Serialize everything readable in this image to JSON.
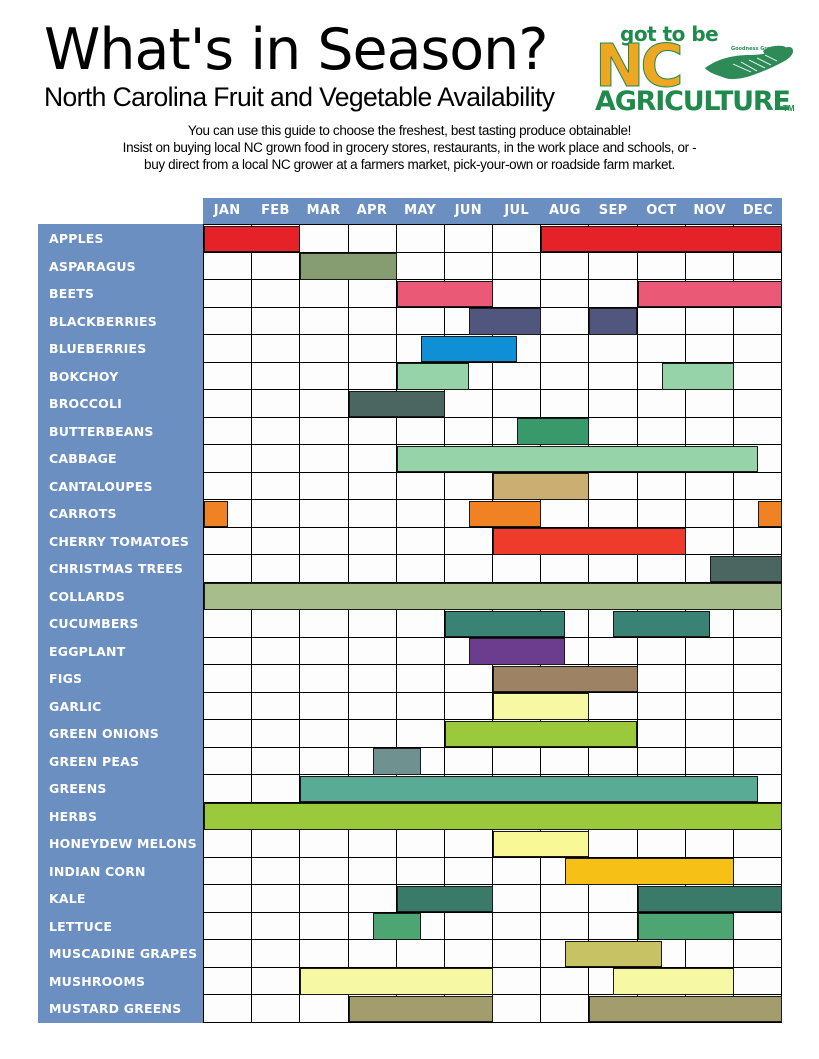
{
  "header": {
    "title": "What's in Season?",
    "subtitle": "North Carolina Fruit and Vegetable Availability",
    "tagline": [
      "You can use this guide to choose the freshest, best tasting produce obtainable!",
      "Insist on buying local NC grown food in grocery stores, restaurants, in the work place and schools, or -",
      "buy direct from a local NC grower at a farmers market, pick-your-own or roadside farm market."
    ],
    "logo": {
      "line1": "got to be",
      "line2": "NC",
      "line3": "AGRICULTURE",
      "trademark": "TM",
      "color_orange": "#eda722",
      "color_green": "#1f8a4c"
    }
  },
  "colors": {
    "sidebar_blue": "#6b8fc0",
    "grid_line": "#000000",
    "cell_background": "#fdfdfd"
  },
  "chart_data": {
    "type": "heatmap",
    "title": "What's in Season? North Carolina Fruit and Vegetable Availability",
    "xlabel": "",
    "ylabel": "",
    "grid": true,
    "legend": "none",
    "categories": [
      "JAN",
      "FEB",
      "MAR",
      "APR",
      "MAY",
      "JUN",
      "JUL",
      "AUG",
      "SEP",
      "OCT",
      "NOV",
      "DEC"
    ],
    "note": "Each row's 'bars' give availability spans as fractional month indices (0 = start of JAN, 12 = end of DEC).",
    "rows": [
      {
        "name": "APPLES",
        "color": "#e62229",
        "bars": [
          [
            0,
            2
          ],
          [
            7,
            12
          ]
        ]
      },
      {
        "name": "ASPARAGUS",
        "color": "#869c71",
        "bars": [
          [
            2,
            4
          ]
        ]
      },
      {
        "name": "BEETS",
        "color": "#ea5a77",
        "bars": [
          [
            4,
            6
          ],
          [
            9,
            12
          ]
        ]
      },
      {
        "name": "BLACKBERRIES",
        "color": "#51567f",
        "bars": [
          [
            5.5,
            7
          ],
          [
            8,
            9
          ]
        ]
      },
      {
        "name": "BLUEBERRIES",
        "color": "#0e8fd6",
        "bars": [
          [
            4.5,
            6.5
          ]
        ]
      },
      {
        "name": "BOKCHOY",
        "color": "#96d3a8",
        "bars": [
          [
            4,
            5.5
          ],
          [
            9.5,
            11
          ]
        ]
      },
      {
        "name": "BROCCOLI",
        "color": "#4b6660",
        "bars": [
          [
            3,
            5
          ]
        ]
      },
      {
        "name": "BUTTERBEANS",
        "color": "#389a6a",
        "bars": [
          [
            6.5,
            8
          ]
        ]
      },
      {
        "name": "CABBAGE",
        "color": "#96d3a8",
        "bars": [
          [
            4,
            11.5
          ]
        ]
      },
      {
        "name": "CANTALOUPES",
        "color": "#cbae72",
        "bars": [
          [
            6,
            8
          ]
        ]
      },
      {
        "name": "CARROTS",
        "color": "#f18224",
        "bars": [
          [
            0,
            0.5
          ],
          [
            5.5,
            7
          ],
          [
            11.5,
            12
          ]
        ]
      },
      {
        "name": "CHERRY   TOMATOES",
        "color": "#ee3b2b",
        "bars": [
          [
            6,
            10
          ]
        ]
      },
      {
        "name": "CHRISTMAS TREES",
        "color": "#4b6660",
        "bars": [
          [
            10.5,
            12
          ]
        ]
      },
      {
        "name": "COLLARDS",
        "color": "#a7bd8c",
        "bars": [
          [
            0,
            12
          ]
        ]
      },
      {
        "name": "CUCUMBERS",
        "color": "#3a8273",
        "bars": [
          [
            5,
            7.5
          ],
          [
            8.5,
            10.5
          ]
        ]
      },
      {
        "name": "EGGPLANT",
        "color": "#6c3d8e",
        "bars": [
          [
            5.5,
            7.5
          ]
        ]
      },
      {
        "name": "FIGS",
        "color": "#9e8264",
        "bars": [
          [
            6,
            9
          ]
        ]
      },
      {
        "name": "GARLIC",
        "color": "#f7f8a4",
        "bars": [
          [
            6,
            8
          ]
        ]
      },
      {
        "name": "GREEN ONIONS",
        "color": "#9ac93c",
        "bars": [
          [
            5,
            9
          ]
        ]
      },
      {
        "name": "GREEN PEAS",
        "color": "#6f9291",
        "bars": [
          [
            3.5,
            4.5
          ]
        ]
      },
      {
        "name": "GREENS",
        "color": "#59ab96",
        "bars": [
          [
            2,
            11.5
          ]
        ]
      },
      {
        "name": "HERBS",
        "color": "#9ac93c",
        "bars": [
          [
            0,
            12
          ]
        ]
      },
      {
        "name": "HONEYDEW MELONS",
        "color": "#f8f996",
        "bars": [
          [
            6,
            8
          ]
        ]
      },
      {
        "name": "INDIAN CORN",
        "color": "#f6c016",
        "bars": [
          [
            7.5,
            11
          ]
        ]
      },
      {
        "name": "KALE",
        "color": "#3a7a68",
        "bars": [
          [
            4,
            6
          ],
          [
            9,
            12
          ]
        ]
      },
      {
        "name": "LETTUCE",
        "color": "#4da571",
        "bars": [
          [
            3.5,
            4.5
          ],
          [
            9,
            11
          ]
        ]
      },
      {
        "name": "MUSCADINE GRAPES",
        "color": "#c7c263",
        "bars": [
          [
            7.5,
            9.5
          ]
        ]
      },
      {
        "name": "MUSHROOMS",
        "color": "#f7f8a4",
        "bars": [
          [
            2,
            6
          ],
          [
            8.5,
            11
          ]
        ]
      },
      {
        "name": "MUSTARD GREENS",
        "color": "#a39c6d",
        "bars": [
          [
            3,
            6
          ],
          [
            8,
            12
          ]
        ]
      }
    ]
  }
}
